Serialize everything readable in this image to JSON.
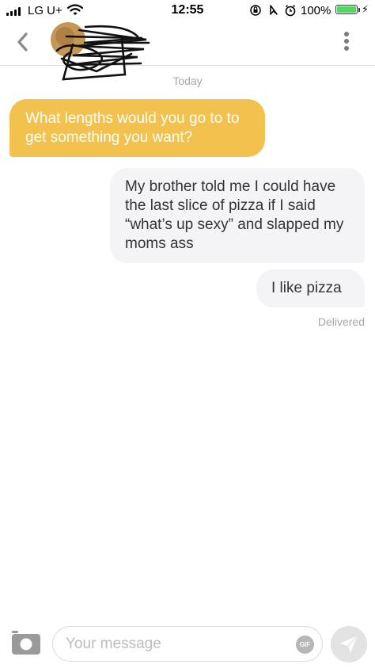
{
  "status_bar": {
    "carrier": "LG U+",
    "time": "12:55",
    "battery_percent": "100%",
    "battery_level": 1.0,
    "icons": [
      "signal-icon",
      "wifi-icon",
      "orientation-lock-icon",
      "location-icon",
      "alarm-icon",
      "battery-icon",
      "charging-bolt-icon"
    ]
  },
  "header": {
    "back_icon": "chevron-left-icon",
    "avatar": "redacted-avatar",
    "menu_icon": "vertical-dots-icon"
  },
  "conversation": {
    "date_label": "Today",
    "messages": [
      {
        "direction": "incoming",
        "text": "What lengths would you go to to get something you want?"
      },
      {
        "direction": "outgoing",
        "text": "My brother told me I could have the last slice of pizza if I said “what’s up sexy” and slapped my moms ass"
      },
      {
        "direction": "outgoing",
        "text": "I like pizza"
      }
    ],
    "delivery_status": "Delivered"
  },
  "composer": {
    "placeholder": "Your message",
    "value": "",
    "gif_label": "GIF",
    "camera_icon": "camera-icon",
    "send_icon": "send-icon"
  },
  "colors": {
    "incoming_bubble": "#f2c14e",
    "outgoing_bubble": "#f4f4f6",
    "battery": "#4cd964"
  }
}
